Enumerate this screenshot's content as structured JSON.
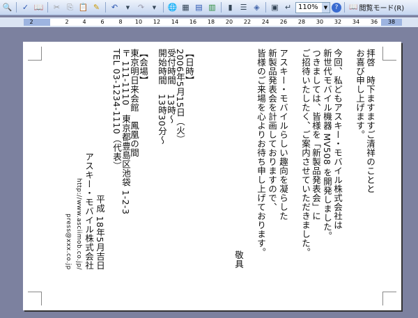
{
  "toolbar": {
    "zoom": "110%",
    "reading_mode": "閲覧モード(R)",
    "icons": [
      "print-preview",
      "spelling",
      "research",
      "cut",
      "copy",
      "paste",
      "format-painter",
      "undo",
      "redo",
      "hyperlink",
      "tables-borders",
      "insert-table",
      "insert-excel",
      "columns",
      "drawing",
      "document-map",
      "show-hide",
      "help"
    ]
  },
  "ruler": {
    "ticks": [
      "2",
      "2",
      "4",
      "6",
      "8",
      "10",
      "12",
      "14",
      "16",
      "18",
      "20",
      "22",
      "24",
      "26",
      "28",
      "30",
      "32",
      "34",
      "36",
      "38"
    ]
  },
  "document": {
    "lines": [
      "拝啓　時下ますますご清祥のことと",
      "お喜び申し上げます。",
      "今回、私どもアスキー・モバイル株式会社は",
      "新世代モバイル機器 MV508 を開発しました。",
      "つきましては、皆様を「新製品発表会」に",
      "ご招待いたしたく、ご案内させていただきました。",
      "アスキー・モバイルらしい趣向を凝らした",
      "新製品発表会を計画しておりますので、",
      "皆様のご来場を心よりお待ち申し上げております。"
    ],
    "closing": "敬具",
    "schedule": [
      "【日時】",
      "2006年5月15日（火）",
      "受付時間　13時～",
      "開始時間　13時30分～"
    ],
    "venue": [
      "【会場】",
      "東京明日来会館　鳳凰の間",
      "〒 111-1110　東京都豊島区池袋 1-2-3",
      "TEL 03-1234-1110（代表）"
    ],
    "date": "平成 18年5月吉日",
    "company": "アスキー・モバイル株式会社",
    "url": "http://www.asciimob.co.jp/",
    "email": "press@xxx.co.jp"
  }
}
